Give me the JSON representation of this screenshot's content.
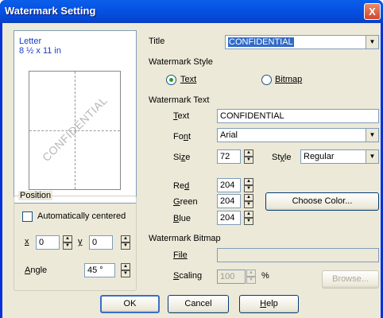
{
  "window": {
    "title": "Watermark Setting",
    "close_glyph": "X"
  },
  "preview": {
    "paper_name": "Letter",
    "paper_size": "8 ½ x 11 in",
    "watermark_text": "CONFIDENTIAL"
  },
  "position": {
    "group_label": "Position",
    "auto_center_label": "Automatically centered",
    "auto_center_checked": false,
    "x_label": "x",
    "x_value": "0",
    "y_label": "y",
    "y_value": "0",
    "angle_label": "Angle",
    "angle_value": "45 °"
  },
  "title": {
    "label": "Title",
    "value": "CONFIDENTIAL"
  },
  "style": {
    "label": "Watermark Style",
    "text_option": "Text",
    "bitmap_option": "Bitmap",
    "selected": "text"
  },
  "wm_text": {
    "section_label": "Watermark Text",
    "text_label": "Text",
    "text_value": "CONFIDENTIAL",
    "font_label": "Font",
    "font_value": "Arial",
    "size_label": "Size",
    "size_value": "72",
    "style_label": "Style",
    "style_value": "Regular",
    "red_label": "Red",
    "red_value": "204",
    "green_label": "Green",
    "green_value": "204",
    "blue_label": "Blue",
    "blue_value": "204",
    "choose_color_label": "Choose Color..."
  },
  "wm_bitmap": {
    "section_label": "Watermark Bitmap",
    "file_label": "File",
    "file_value": "",
    "scaling_label": "Scaling",
    "scaling_value": "100",
    "scaling_unit": "%",
    "browse_label": "Browse..."
  },
  "buttons": {
    "ok": "OK",
    "cancel": "Cancel",
    "help": "Help"
  },
  "icons": {
    "spin_up": "▲",
    "spin_down": "▼",
    "dropdown": "▼"
  },
  "colors": {
    "titlebar": "#0653e3",
    "dialog_bg": "#ece9d8",
    "selection": "#316ac5",
    "radio_dot": "#21a121"
  }
}
